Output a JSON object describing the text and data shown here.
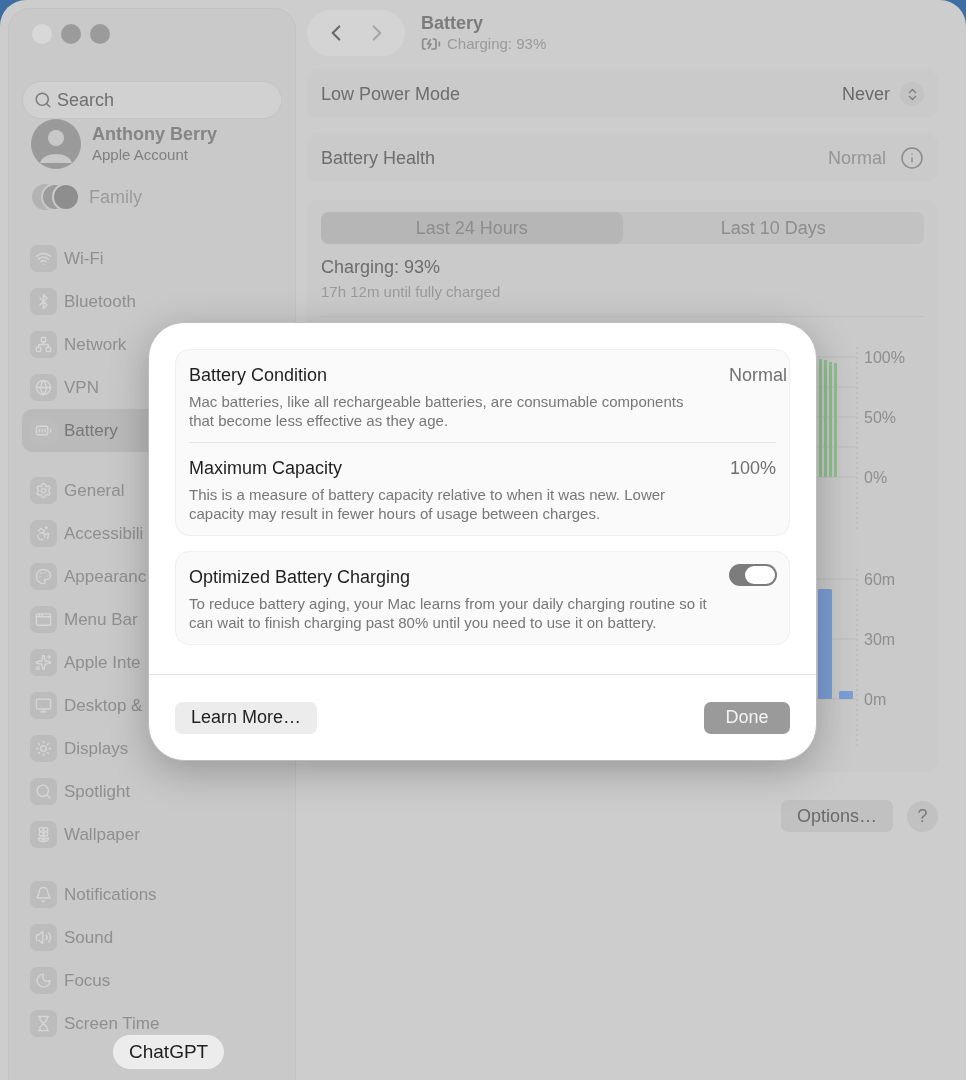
{
  "window": {
    "title": "Battery",
    "subtitle": "Charging: 93%"
  },
  "sidebar": {
    "search": {
      "placeholder": "Search"
    },
    "account": {
      "name": "Anthony Berry",
      "subtitle": "Apple Account"
    },
    "family": {
      "label": "Family"
    },
    "sections": [
      {
        "items": [
          {
            "label": "Wi-Fi",
            "selected": false
          },
          {
            "label": "Bluetooth",
            "selected": false
          },
          {
            "label": "Network",
            "selected": false
          },
          {
            "label": "VPN",
            "selected": false
          },
          {
            "label": "Battery",
            "selected": true
          }
        ]
      },
      {
        "items": [
          {
            "label": "General",
            "selected": false
          },
          {
            "label": "Accessibili",
            "selected": false
          },
          {
            "label": "Appearanc",
            "selected": false
          },
          {
            "label": "Menu Bar",
            "selected": false
          },
          {
            "label": "Apple Inte",
            "selected": false
          },
          {
            "label": "Desktop &",
            "selected": false
          },
          {
            "label": "Displays",
            "selected": false
          },
          {
            "label": "Spotlight",
            "selected": false
          },
          {
            "label": "Wallpaper",
            "selected": false
          }
        ]
      },
      {
        "items": [
          {
            "label": "Notifications",
            "selected": false
          },
          {
            "label": "Sound",
            "selected": false
          },
          {
            "label": "Focus",
            "selected": false
          },
          {
            "label": "Screen Time",
            "selected": false
          }
        ]
      }
    ]
  },
  "settings": {
    "low_power_mode": {
      "label": "Low Power Mode",
      "value": "Never"
    },
    "battery_health": {
      "label": "Battery Health",
      "value": "Normal"
    }
  },
  "usage": {
    "tabs": [
      {
        "label": "Last 24 Hours",
        "selected": true
      },
      {
        "label": "Last 10 Days",
        "selected": false
      }
    ],
    "status": "Charging: 93%",
    "detail": "17h 12m until fully charged",
    "level_chart": {
      "axis_labels": [
        "100%",
        "50%",
        "0%"
      ]
    },
    "usage_chart": {
      "chart_data": {
        "type": "bar",
        "yticks": [
          {
            "value": 0,
            "label": "0m"
          },
          {
            "value": 30,
            "label": "30m"
          },
          {
            "value": 60,
            "label": "60m"
          }
        ],
        "ylim": [
          0,
          60
        ],
        "series": [
          {
            "color": "#7b9fd4",
            "values": [
              55,
              4
            ]
          }
        ]
      }
    }
  },
  "footer": {
    "options": "Options…",
    "help": "?"
  },
  "dialog": {
    "groups": [
      {
        "rows": [
          {
            "title": "Battery Condition",
            "description": "Mac batteries, like all rechargeable batteries, are consumable components that become less effective as they age.",
            "value": "Normal"
          },
          {
            "title": "Maximum Capacity",
            "description": "This is a measure of battery capacity relative to when it was new. Lower capacity may result in fewer hours of usage between charges.",
            "value": "100%"
          }
        ]
      },
      {
        "rows": [
          {
            "title": "Optimized Battery Charging",
            "description": "To reduce battery aging, your Mac learns from your daily charging routine so it can wait to finish charging past 80% until you need to use it on battery.",
            "on": true
          }
        ]
      }
    ],
    "learn_more": "Learn More…",
    "done": "Done"
  },
  "dock_tooltip": "ChatGPT"
}
